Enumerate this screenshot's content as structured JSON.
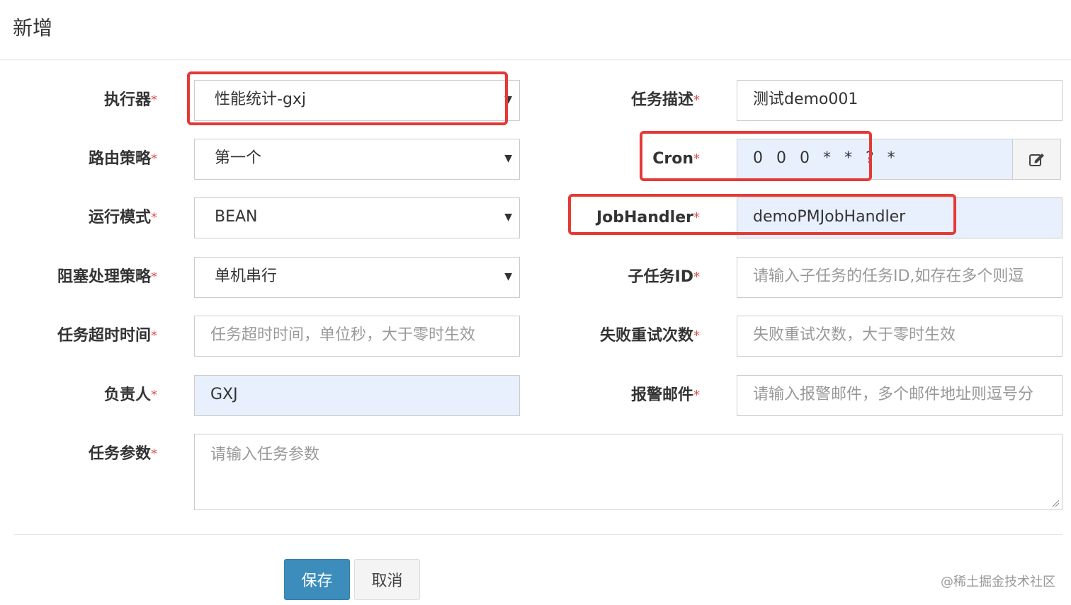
{
  "modal": {
    "title": "新增"
  },
  "form": {
    "required_mark": "*",
    "executor": {
      "label": "执行器",
      "value": "性能统计-gxj"
    },
    "route_strategy": {
      "label": "路由策略",
      "value": "第一个"
    },
    "run_mode": {
      "label": "运行模式",
      "value": "BEAN"
    },
    "block_strategy": {
      "label": "阻塞处理策略",
      "value": "单机串行"
    },
    "timeout": {
      "label": "任务超时时间",
      "placeholder": "任务超时时间，单位秒，大于零时生效"
    },
    "owner": {
      "label": "负责人",
      "value": "GXJ"
    },
    "params": {
      "label": "任务参数",
      "placeholder": "请输入任务参数"
    },
    "task_desc": {
      "label": "任务描述",
      "value": "测试demo001"
    },
    "cron": {
      "label": "Cron",
      "value": "0 0 0 * * ? *"
    },
    "job_handler": {
      "label": "JobHandler",
      "value": "demoPMJobHandler"
    },
    "child_id": {
      "label": "子任务ID",
      "placeholder": "请输入子任务的任务ID,如存在多个则逗"
    },
    "retry": {
      "label": "失败重试次数",
      "placeholder": "失败重试次数，大于零时生效"
    },
    "alarm_email": {
      "label": "报警邮件",
      "placeholder": "请输入报警邮件，多个邮件地址则逗号分"
    }
  },
  "buttons": {
    "save": "保存",
    "cancel": "取消"
  },
  "watermark": "@稀土掘金技术社区",
  "colors": {
    "primary": "#3c8dbc",
    "highlight": "#e53935",
    "autofill": "#e8f0fe"
  },
  "icons": {
    "cron_edit": "edit-icon",
    "select": "caret-down-icon"
  }
}
